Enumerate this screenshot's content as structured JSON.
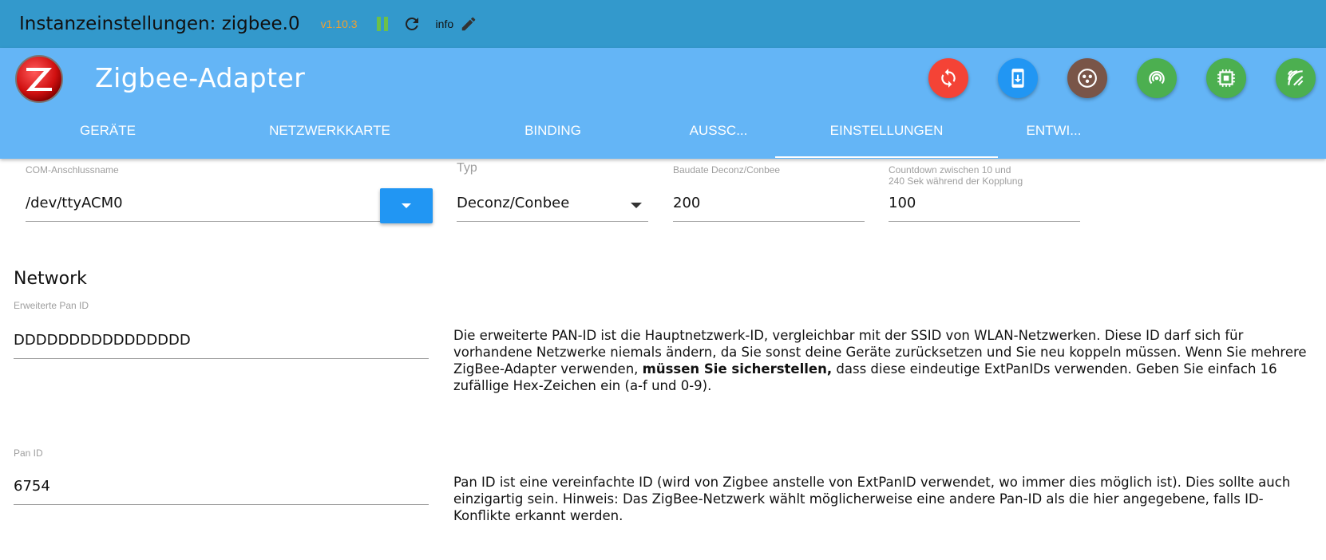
{
  "titlebar": {
    "title": "Instanzeinstellungen: zigbee.0",
    "version": "v1.10.3",
    "loglevel": "info",
    "colors": {
      "background": "#3399cc",
      "version": "#f0a030",
      "pause": "#6cc04a"
    }
  },
  "header": {
    "adapter_name": "Zigbee-Adapter",
    "logo_icon": "zigbee-logo-icon",
    "background": "#64b5f6",
    "actions": [
      {
        "name": "reset-button",
        "icon": "sync-icon",
        "color": "#f44336"
      },
      {
        "name": "download-button",
        "icon": "phone-download-icon",
        "color": "#2196f3"
      },
      {
        "name": "pairing-button",
        "icon": "zigbee-dots-icon",
        "color": "#795548"
      },
      {
        "name": "scan-button",
        "icon": "wifi-ring-icon",
        "color": "#4caf50"
      },
      {
        "name": "chip-button",
        "icon": "chip-icon",
        "color": "#4caf50"
      },
      {
        "name": "signal-button",
        "icon": "signal-off-icon",
        "color": "#4caf50"
      }
    ]
  },
  "tabs": [
    {
      "label": "GERÄTE",
      "active": false
    },
    {
      "label": "NETZWERKKARTE",
      "active": false
    },
    {
      "label": "BINDING",
      "active": false
    },
    {
      "label": "AUSSC...",
      "active": false
    },
    {
      "label": "EINSTELLUNGEN",
      "active": true
    },
    {
      "label": "ENTWI...",
      "active": false
    }
  ],
  "settings": {
    "com_port": {
      "label": "COM-Anschlussname",
      "value": "/dev/ttyACM0"
    },
    "type": {
      "label": "Typ",
      "value": "Deconz/Conbee"
    },
    "baudrate": {
      "label": "Baudate Deconz/Conbee",
      "value": "200"
    },
    "countdown": {
      "label_line1": "Countdown zwischen 10 und",
      "label_line2": "240 Sek während der Kopplung",
      "value": "100"
    }
  },
  "network": {
    "title": "Network",
    "ext_pan_id": {
      "label": "Erweiterte Pan ID",
      "value": "DDDDDDDDDDDDDDDD",
      "help_part1": "Die erweiterte PAN-ID ist die Hauptnetzwerk-ID, vergleichbar mit der SSID von WLAN-Netzwerken. Diese ID darf sich für vorhandene Netzwerke niemals ändern, da Sie sonst deine Geräte zurücksetzen und Sie neu koppeln müssen. Wenn Sie mehrere ZigBee-Adapter verwenden, ",
      "help_bold": "müssen Sie sicherstellen,",
      "help_part2": " dass diese eindeutige ExtPanIDs verwenden. Geben Sie einfach 16 zufällige Hex-Zeichen ein (a-f und 0-9)."
    },
    "pan_id": {
      "label": "Pan ID",
      "value": "6754",
      "help": "Pan ID ist eine vereinfachte ID (wird von Zigbee anstelle von ExtPanID verwendet, wo immer dies möglich ist). Dies sollte auch einzigartig sein. Hinweis: Das ZigBee-Netzwerk wählt möglicherweise eine andere Pan-ID als die hier angegebene, falls ID-Konflikte erkannt werden."
    }
  }
}
